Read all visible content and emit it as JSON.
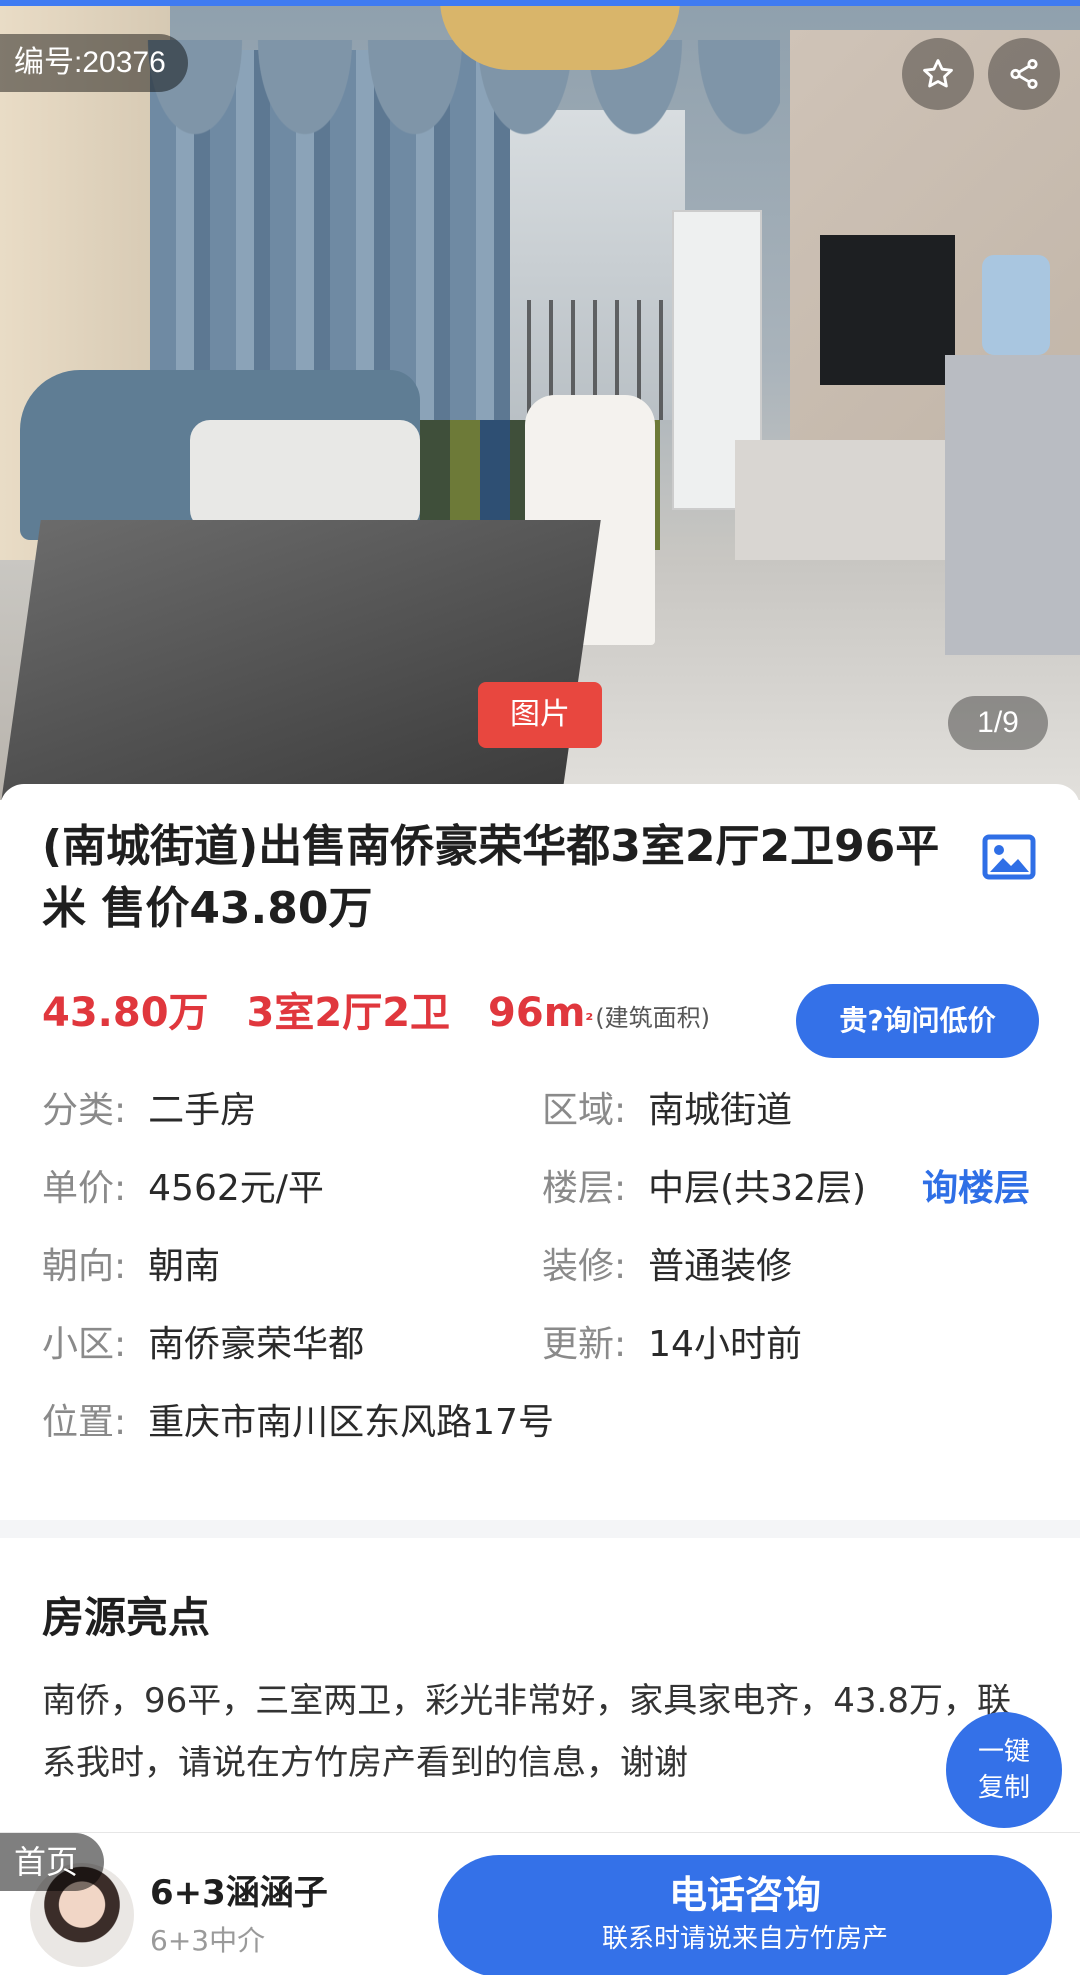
{
  "hero": {
    "code_badge": "编号:20376",
    "photo_tag": "图片",
    "counter": "1/9",
    "fav_icon": "star-icon",
    "share_icon": "share-icon"
  },
  "listing": {
    "title": "(南城街道)出售南侨豪荣华都3室2厅2卫96平米 售价43.80万",
    "price": "43.80万",
    "rooms": "3室2厅2卫",
    "area": "96m",
    "area_sup": "²",
    "area_note": "(建筑面积)",
    "ask_price_button": "贵?询问低价",
    "ask_floor_link": "询楼层"
  },
  "details": {
    "category_label": "分类:",
    "category_value": "二手房",
    "region_label": "区域:",
    "region_value": "南城街道",
    "unit_price_label": "单价:",
    "unit_price_value": "4562元/平",
    "floor_label": "楼层:",
    "floor_value": "中层(共32层)",
    "orientation_label": "朝向:",
    "orientation_value": "朝南",
    "decoration_label": "装修:",
    "decoration_value": "普通装修",
    "community_label": "小区:",
    "community_value": "南侨豪荣华都",
    "updated_label": "更新:",
    "updated_value": "14小时前",
    "location_label": "位置:",
    "location_value": "重庆市南川区东风路17号"
  },
  "highlights": {
    "title": "房源亮点",
    "text": "南侨，96平，三室两卫，彩光非常好，家具家电齐，43.8万，联系我时，请说在方竹房产看到的信息，谢谢",
    "copy_line1": "一键",
    "copy_line2": "复制"
  },
  "bottom": {
    "home_tag": "首页",
    "agent_name": "6+3涵涵子",
    "agent_org": "6+3中介",
    "call_main": "电话咨询",
    "call_sub": "联系时请说来自方竹房产"
  },
  "colors": {
    "accent_blue": "#3471e8",
    "price_red": "#e0373d",
    "tag_red": "#e8473f"
  }
}
